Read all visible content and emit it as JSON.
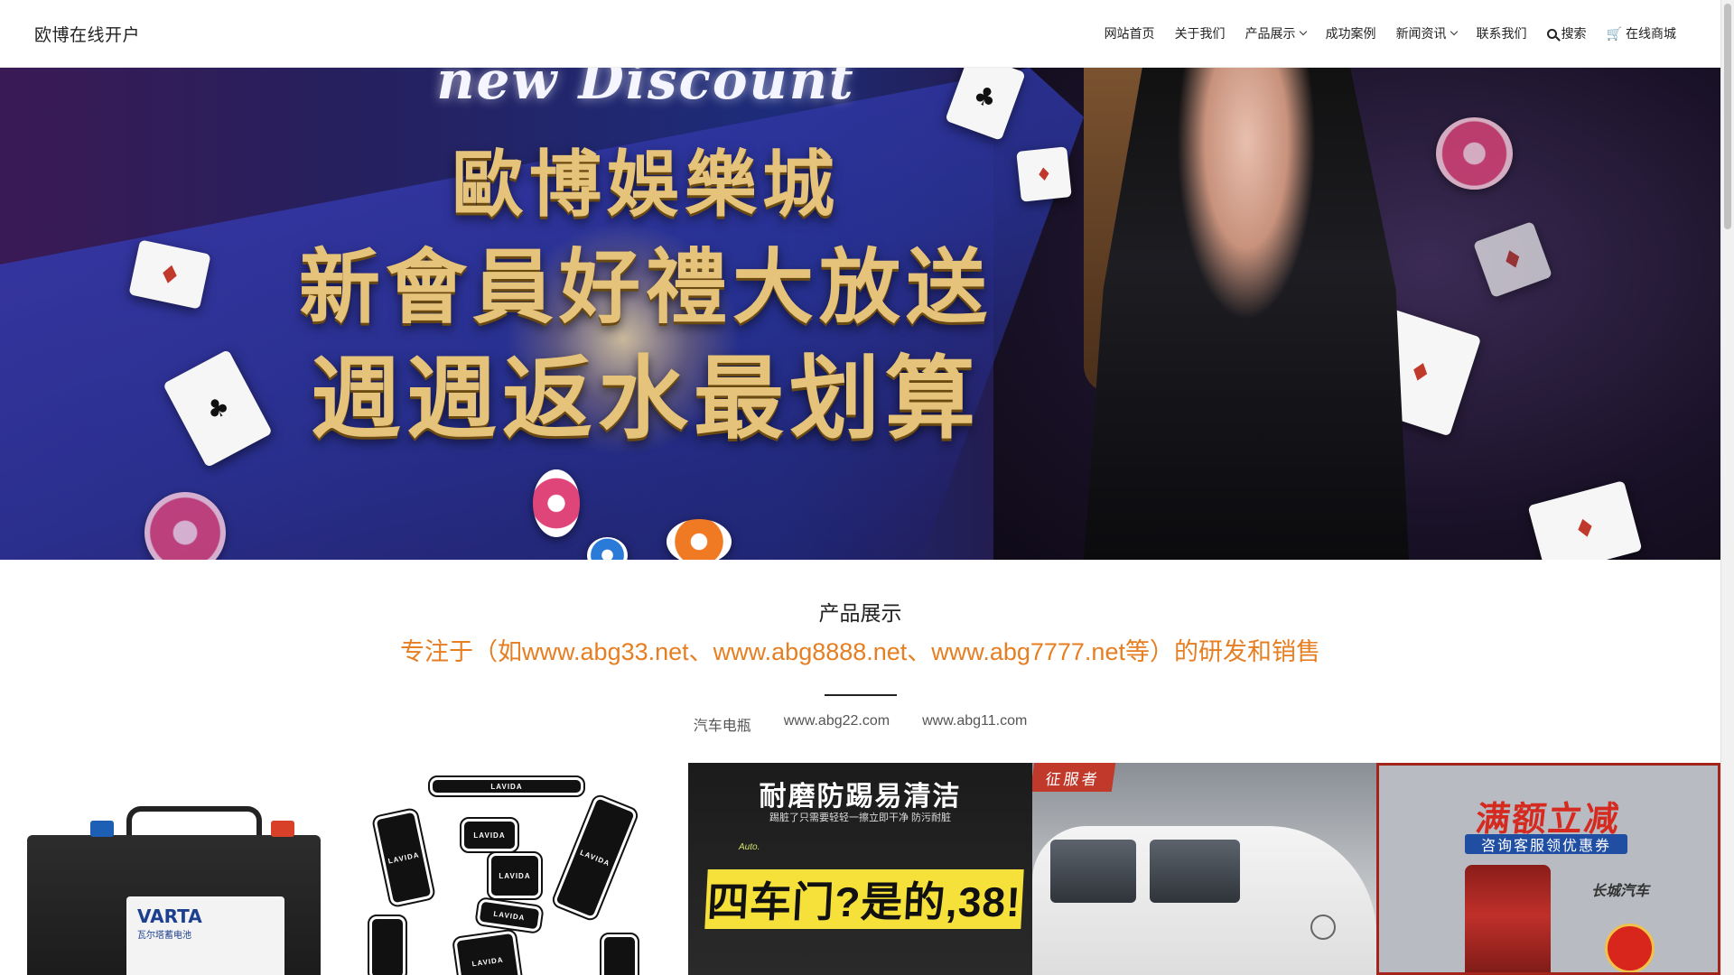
{
  "header": {
    "site_title": "欧博在线开户",
    "nav": [
      {
        "label": "网站首页",
        "dropdown": false
      },
      {
        "label": "关于我们",
        "dropdown": false
      },
      {
        "label": "产品展示",
        "dropdown": true
      },
      {
        "label": "成功案例",
        "dropdown": false
      },
      {
        "label": "新闻资讯",
        "dropdown": true
      },
      {
        "label": "联系我们",
        "dropdown": false
      },
      {
        "label": "搜索",
        "icon": "search-icon"
      },
      {
        "label": "在线商城",
        "icon": "cart-icon"
      }
    ]
  },
  "banner": {
    "top_script": "new Discount",
    "line1": "歐博娛樂城",
    "line2": "新會員好禮大放送",
    "line3": "週週返水最划算"
  },
  "section": {
    "title": "产品展示",
    "subtitle": "专注于（如www.abg33.net、www.abg8888.net、www.abg7777.net等）的研发和销售",
    "filters": [
      "汽车电瓶",
      "www.abg22.com",
      "www.abg11.com"
    ]
  },
  "products": {
    "p1": {
      "brand": "VARTA",
      "brand_sub": "瓦尔塔蓄电池"
    },
    "p2": {
      "mat_label": "LAVIDA"
    },
    "p3": {
      "title": "耐磨防踢易清洁",
      "small": "踢脏了只需要轻轻一擦立即干净 防污耐脏",
      "tag": "Auto.",
      "big": "四车门?是的,38!"
    },
    "p4": {
      "badge": "征服者"
    },
    "p5": {
      "headline": "满额立减",
      "sub": "咨询客服领优惠券",
      "logo": "长城汽车"
    }
  },
  "colors": {
    "accent_orange": "#e67e22",
    "banner_gold": "#e6c37a",
    "highlight_border": "#a3241b"
  }
}
